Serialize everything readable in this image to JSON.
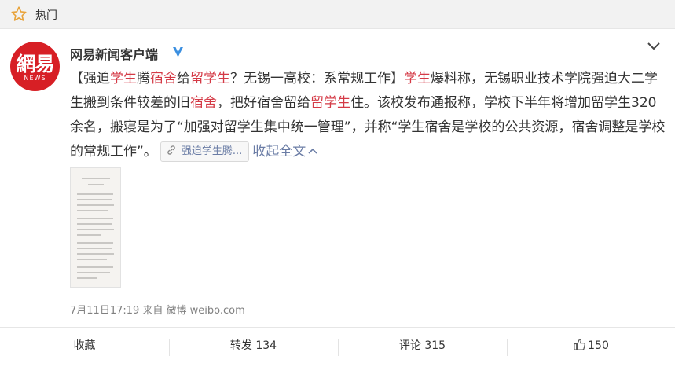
{
  "header": {
    "title": "热门",
    "icon": "star-outline-icon"
  },
  "post": {
    "author": "网易新闻客户端",
    "avatar": {
      "main": "網易",
      "sub": "NEWS",
      "color": "#d71f25"
    },
    "verified_icon": "verified-badge-icon",
    "body": {
      "seg1": "【强迫",
      "seg2": "学生",
      "seg3": "腾",
      "seg4": "宿舍",
      "seg5": "给",
      "seg6": "留学生",
      "seg7": "？无锡一高校：系常规工作】",
      "seg8": "学生",
      "seg9": "爆料称，无锡职业技术学院强迫大二学生搬到条件较差的旧",
      "seg10": "宿舍",
      "seg11": "，把好宿舍留给",
      "seg12": "留学生",
      "seg13": "住。该校发布通报称，学校下半年将增加留学生320余名，搬寝是为了“加强对留学生集中统一管理”，并称“学生宿舍是学校的公共资源，宿舍调整是学校的常规工作”。"
    },
    "link_chip": "强迫学生腾...",
    "collapse_label": "收起全文",
    "meta": "7月11日17:19 来自 微博 weibo.com",
    "highlight_color": "#d43a46",
    "link_color": "#6a7ca5"
  },
  "actions": {
    "favorite": "收藏",
    "repost": "转发 134",
    "comment": "评论 315",
    "like": "150"
  }
}
